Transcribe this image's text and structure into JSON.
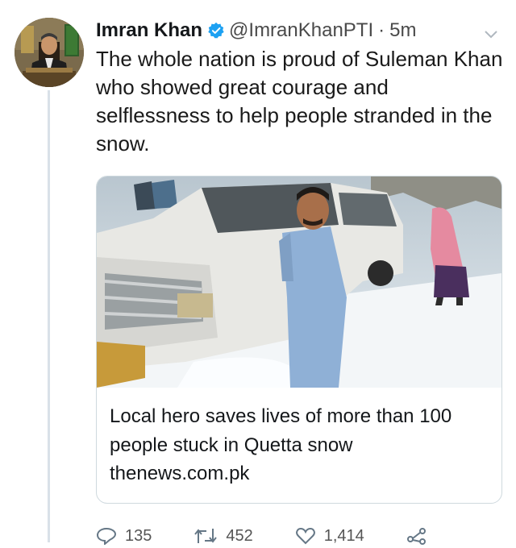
{
  "tweet": {
    "author_name": "Imran Khan",
    "handle": "@ImranKhanPTI",
    "separator": "·",
    "time": "5m",
    "text": "The whole nation is proud of Suleman Khan who showed great courage and selflessness to help people stranded in the snow.",
    "verified_color": "#1da1f2"
  },
  "card": {
    "title": "Local hero saves lives of more than 100 people stuck in Quetta snow",
    "domain": "thenews.com.pk"
  },
  "actions": {
    "replies": "135",
    "retweets": "452",
    "likes": "1,414",
    "icons": [
      "reply-icon",
      "retweet-icon",
      "like-icon",
      "share-icon"
    ]
  }
}
